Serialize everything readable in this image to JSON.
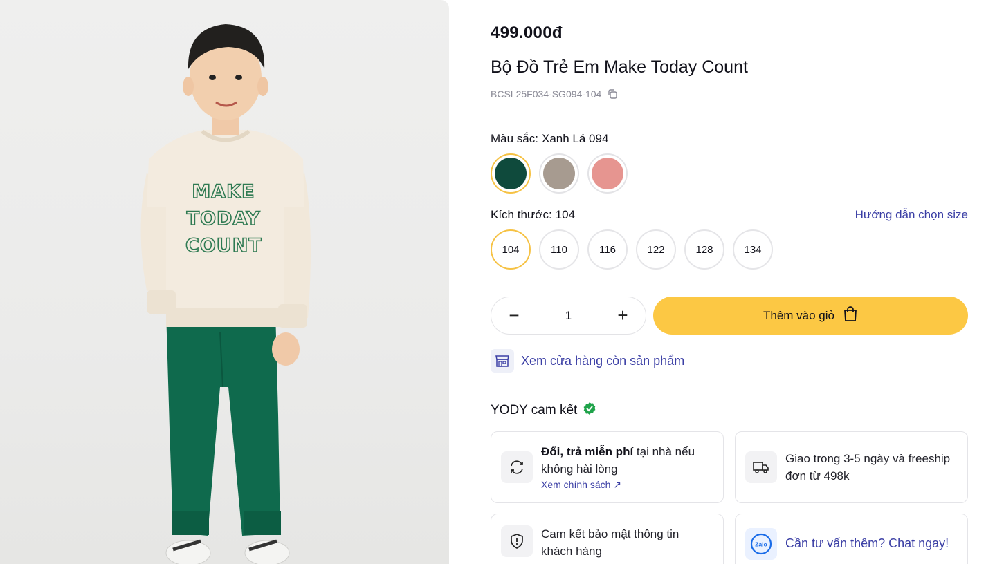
{
  "product": {
    "price": "499.000đ",
    "title": "Bộ Đồ Trẻ Em Make Today Count",
    "sku": "BCSL25F034-SG094-104",
    "shirt_text": [
      "MAKE",
      "TODAY",
      "COUNT"
    ]
  },
  "color": {
    "label": "Màu sắc:",
    "selected": "Xanh Lá 094",
    "swatches": [
      {
        "color": "#0f4a3c"
      },
      {
        "color": "#a79b90"
      },
      {
        "color": "#e69590"
      }
    ]
  },
  "size": {
    "label": "Kích thước:",
    "selected": "104",
    "guide": "Hướng dẫn chọn size",
    "options": [
      "104",
      "110",
      "116",
      "122",
      "128",
      "134"
    ]
  },
  "quantity": {
    "value": "1",
    "minus": "−",
    "plus": "+"
  },
  "cart": {
    "add_label": "Thêm vào giỏ"
  },
  "store": {
    "link": "Xem cửa hàng còn sản phẩm"
  },
  "commitment": {
    "title": "YODY cam kết",
    "return_bold": "Đổi, trả miễn phí",
    "return_text": " tại nhà nếu không hài lòng",
    "return_link": "Xem chính sách ↗",
    "shipping": "Giao trong 3-5 ngày và freeship đơn từ 498k",
    "privacy": "Cam kết bảo mật thông tin khách hàng",
    "chat": "Cần tư vấn thêm? Chat ngay!",
    "zalo": "Zalo"
  },
  "colors": {
    "accent": "#fcc844",
    "link": "#3b3fa5",
    "verified": "#1fa34a"
  }
}
